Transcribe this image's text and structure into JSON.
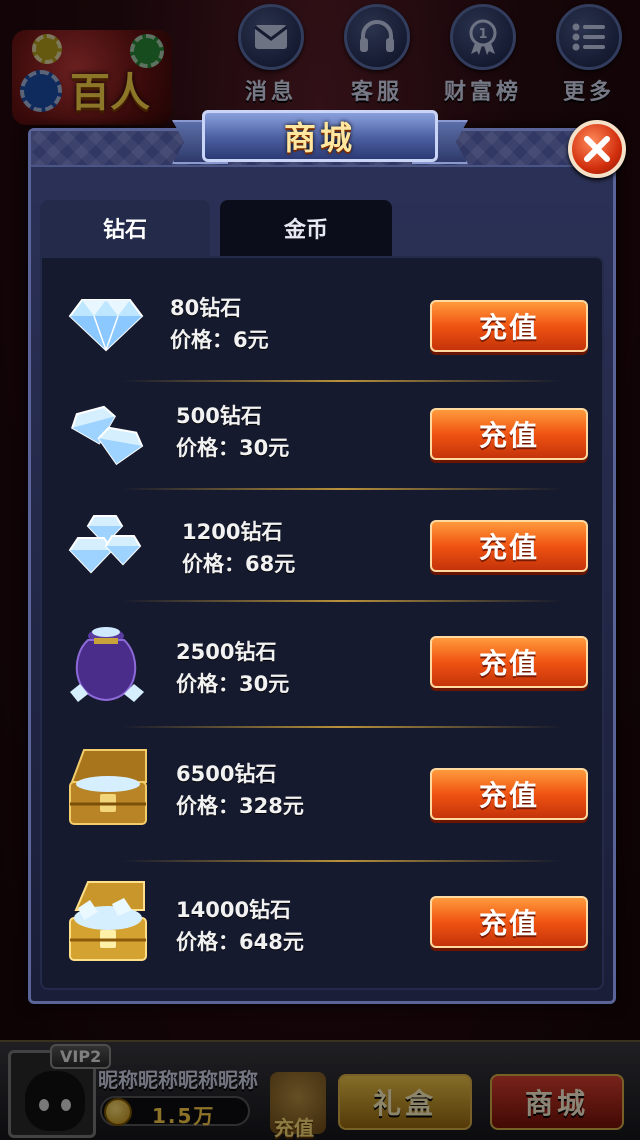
{
  "top_bar": {
    "logo_text": "百人",
    "icons": [
      {
        "label": "消息",
        "icon": "mail-icon"
      },
      {
        "label": "客服",
        "icon": "headset-icon"
      },
      {
        "label": "财富榜",
        "icon": "medal-icon"
      },
      {
        "label": "更多",
        "icon": "list-icon"
      }
    ]
  },
  "shop": {
    "title": "商城",
    "tabs": [
      {
        "label": "钻石",
        "active": true
      },
      {
        "label": "金币",
        "active": false
      }
    ],
    "items": [
      {
        "name": "80钻石",
        "price": "价格：6元",
        "button": "充值",
        "icon": "diamond-icon"
      },
      {
        "name": "500钻石",
        "price": "价格：30元",
        "button": "充值",
        "icon": "diamond-pair-icon"
      },
      {
        "name": "1200钻石",
        "price": "价格：68元",
        "button": "充值",
        "icon": "diamond-pile-icon"
      },
      {
        "name": "2500钻石",
        "price": "价格：30元",
        "button": "充值",
        "icon": "diamond-bag-icon"
      },
      {
        "name": "6500钻石",
        "price": "价格：328元",
        "button": "充值",
        "icon": "treasure-chest-icon"
      },
      {
        "name": "14000钻石",
        "price": "价格：648元",
        "button": "充值",
        "icon": "gold-chest-icon"
      }
    ]
  },
  "bottom_bar": {
    "vip": "VIP2",
    "nickname": "昵称昵称昵称昵称",
    "coins": "1.5万",
    "recharge": "充值",
    "gift_button": "礼盒",
    "mall_button": "商城"
  },
  "colors": {
    "accent": "#f05412",
    "dialog_bg": "#2c3258",
    "panel_bg": "#161a2e",
    "gold": "#b8913a"
  }
}
